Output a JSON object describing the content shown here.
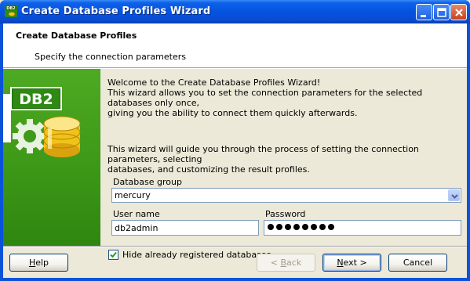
{
  "window": {
    "title": "Create Database Profiles Wizard",
    "app_icon_text": "DB2"
  },
  "header": {
    "title": "Create Database Profiles",
    "subtitle": "Specify the connection parameters"
  },
  "side_panel": {
    "logo_text": "DB2"
  },
  "content": {
    "welcome_line1": "Welcome to the Create Database Profiles Wizard!",
    "welcome_line2": "This wizard allows you to set the connection parameters for the selected databases only once,",
    "welcome_line3": "giving you the ability to connect them quickly afterwards.",
    "guide_line1": "This wizard will guide you through the process of setting the connection parameters, selecting",
    "guide_line2": "databases, and customizing the result profiles."
  },
  "form": {
    "database_group_label": "Database group",
    "database_group_value": "mercury",
    "user_name_label": "User name",
    "user_name_value": "db2admin",
    "password_label": "Password",
    "password_masked_length": 8,
    "hide_registered_label": "Hide already registered databases",
    "hide_registered_checked": true
  },
  "buttons": {
    "help": {
      "pre": "",
      "ul": "H",
      "post": "elp"
    },
    "back": {
      "pre": "< ",
      "ul": "B",
      "post": "ack"
    },
    "next": {
      "pre": "",
      "ul": "N",
      "post": "ext >"
    },
    "cancel": "Cancel"
  },
  "colors": {
    "title_bar": "#0553E0",
    "side_panel_green": "#3E9A18",
    "window_bg": "#ECE9D8"
  }
}
